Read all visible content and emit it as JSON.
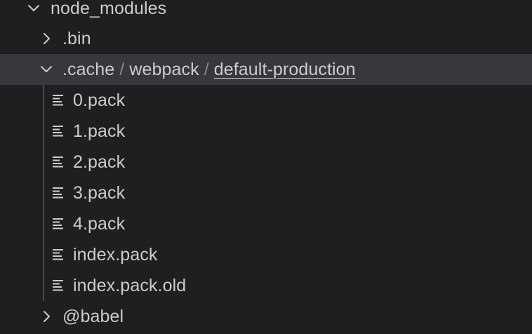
{
  "explorer": {
    "root_folder": {
      "label": "node_modules",
      "state": "expanded"
    },
    "bin_folder": {
      "label": ".bin",
      "state": "collapsed"
    },
    "cache_path": {
      "state": "expanded",
      "segments": [
        ".cache",
        "webpack",
        "default-production"
      ],
      "separator": "/"
    },
    "files": [
      {
        "label": "0.pack"
      },
      {
        "label": "1.pack"
      },
      {
        "label": "2.pack"
      },
      {
        "label": "3.pack"
      },
      {
        "label": "4.pack"
      },
      {
        "label": "index.pack"
      },
      {
        "label": "index.pack.old"
      }
    ],
    "babel_folder": {
      "label": "@babel",
      "state": "collapsed"
    }
  },
  "colors": {
    "background": "#1f1f21",
    "selected_row": "#37373d",
    "text": "#cccccc",
    "separator": "#8a8a8a",
    "indent_guide": "#4a4a4e"
  },
  "icons": {
    "expanded": "chevron-down-icon",
    "collapsed": "chevron-right-icon",
    "file": "file-lines-icon"
  }
}
